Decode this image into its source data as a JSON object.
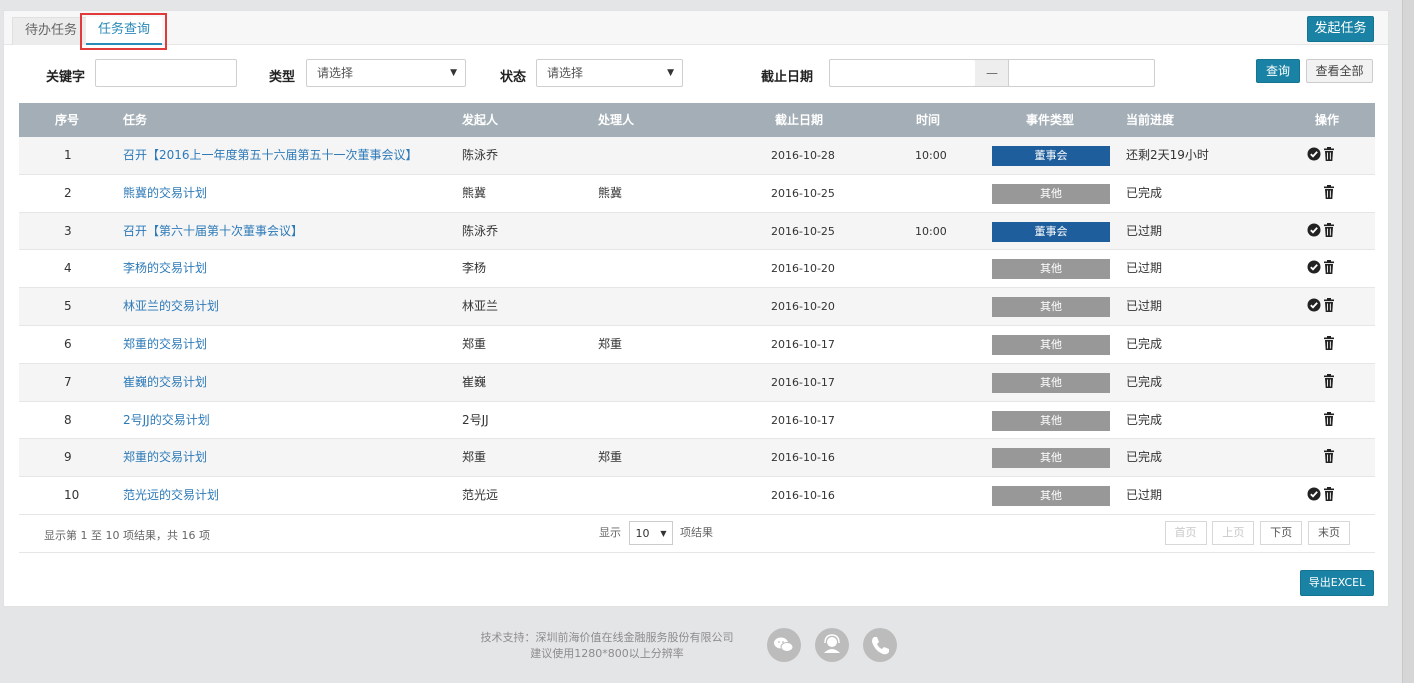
{
  "tabs": [
    {
      "label": "待办任务"
    },
    {
      "label": "任务查询"
    }
  ],
  "launch_button": "发起任务",
  "filters": {
    "keyword_label": "关键字",
    "keyword_value": "",
    "type_label": "类型",
    "type_value": "请选择",
    "status_label": "状态",
    "status_value": "请选择",
    "deadline_label": "截止日期",
    "date_separator": "—",
    "query_button": "查询",
    "view_all_button": "查看全部"
  },
  "table": {
    "headers": {
      "index": "序号",
      "task": "任务",
      "initiator": "发起人",
      "handler": "处理人",
      "deadline": "截止日期",
      "time": "时间",
      "event_type": "事件类型",
      "progress": "当前进度",
      "actions": "操作"
    },
    "rows": [
      {
        "index": "1",
        "task": "召开【2016上一年度第五十六届第五十一次董事会议】",
        "initiator": "陈泳乔",
        "handler": "",
        "deadline": "2016-10-28",
        "time": "10:00",
        "event_type": "董事会",
        "progress": "还剩2天19小时"
      },
      {
        "index": "2",
        "task": "熊冀的交易计划",
        "initiator": "熊冀",
        "handler": "熊冀",
        "deadline": "2016-10-25",
        "time": "",
        "event_type": "其他",
        "progress": "已完成"
      },
      {
        "index": "3",
        "task": "召开【第六十届第十次董事会议】",
        "initiator": "陈泳乔",
        "handler": "",
        "deadline": "2016-10-25",
        "time": "10:00",
        "event_type": "董事会",
        "progress": "已过期"
      },
      {
        "index": "4",
        "task": "李杨的交易计划",
        "initiator": "李杨",
        "handler": "",
        "deadline": "2016-10-20",
        "time": "",
        "event_type": "其他",
        "progress": "已过期"
      },
      {
        "index": "5",
        "task": "林亚兰的交易计划",
        "initiator": "林亚兰",
        "handler": "",
        "deadline": "2016-10-20",
        "time": "",
        "event_type": "其他",
        "progress": "已过期"
      },
      {
        "index": "6",
        "task": "郑重的交易计划",
        "initiator": "郑重",
        "handler": "郑重",
        "deadline": "2016-10-17",
        "time": "",
        "event_type": "其他",
        "progress": "已完成"
      },
      {
        "index": "7",
        "task": "崔巍的交易计划",
        "initiator": "崔巍",
        "handler": "",
        "deadline": "2016-10-17",
        "time": "",
        "event_type": "其他",
        "progress": "已完成"
      },
      {
        "index": "8",
        "task": "2号JJ的交易计划",
        "initiator": "2号JJ",
        "handler": "",
        "deadline": "2016-10-17",
        "time": "",
        "event_type": "其他",
        "progress": "已完成"
      },
      {
        "index": "9",
        "task": "郑重的交易计划",
        "initiator": "郑重",
        "handler": "郑重",
        "deadline": "2016-10-16",
        "time": "",
        "event_type": "其他",
        "progress": "已完成"
      },
      {
        "index": "10",
        "task": "范光远的交易计划",
        "initiator": "范光远",
        "handler": "",
        "deadline": "2016-10-16",
        "time": "",
        "event_type": "其他",
        "progress": "已过期"
      }
    ]
  },
  "pagination": {
    "info": "显示第 1 至 10 项结果，共 16 项",
    "show_label": "显示",
    "page_size": "10",
    "results_label": "项结果",
    "first": "首页",
    "prev": "上页",
    "next": "下页",
    "last": "末页"
  },
  "export_button": "导出EXCEL",
  "footer": {
    "support": "技术支持：深圳前海价值在线金融服务股份有限公司",
    "resolution": "建议使用1280*800以上分辨率",
    "icons": [
      "wechat-icon",
      "customer-service-icon",
      "phone-icon"
    ]
  },
  "colors": {
    "accent": "#1a83a5",
    "board_badge": "#1f5e9d",
    "other_badge": "#989898",
    "header_bg": "#a3aeb6",
    "link": "#2d7ab8",
    "highlight": "#e03a3a"
  }
}
